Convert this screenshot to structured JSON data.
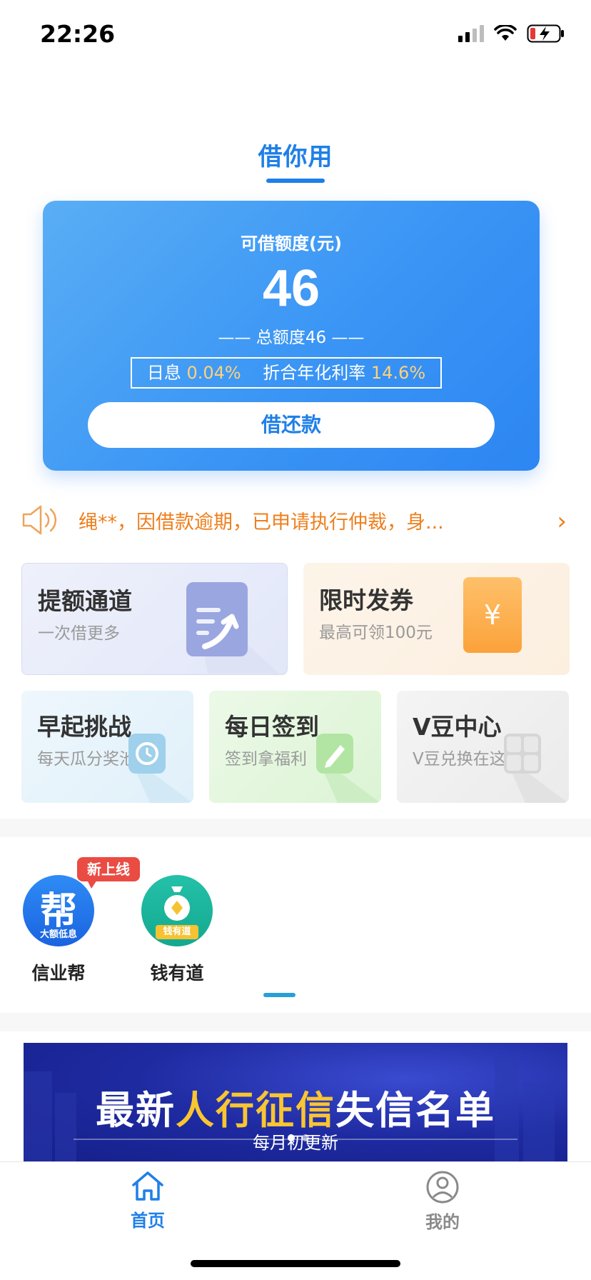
{
  "status_bar": {
    "time": "22:26"
  },
  "page": {
    "title": "借你用"
  },
  "credit_card": {
    "label": "可借额度(元)",
    "amount": "46",
    "total": "—— 总额度46 ——",
    "daily_rate_label": "日息",
    "daily_rate_value": "0.04%",
    "annual_rate_label": "折合年化利率",
    "annual_rate_value": "14.6%",
    "button_label": "借还款"
  },
  "notice": {
    "text": "绳**，因借款逾期，已申请执行仲裁，身...",
    "arrow": "›"
  },
  "tiles": [
    {
      "title": "提额通道",
      "subtitle": "一次借更多",
      "icon": "document-arrow-icon"
    },
    {
      "title": "限时发券",
      "subtitle": "最高可领100元",
      "icon": "coupon-icon",
      "icon_glyph": "¥"
    },
    {
      "title": "早起挑战",
      "subtitle": "每天瓜分奖池",
      "icon": "alarm-clock-icon"
    },
    {
      "title": "每日签到",
      "subtitle": "签到拿福利",
      "icon": "pencil-icon"
    },
    {
      "title": "V豆中心",
      "subtitle": "V豆兑换在这里",
      "icon": "cube-icon"
    }
  ],
  "apps": [
    {
      "name": "信业帮",
      "icon_text": "帮",
      "icon_caption": "大额低息",
      "badge": "新上线"
    },
    {
      "name": "钱有道",
      "icon_caption": "钱有道"
    }
  ],
  "banner": {
    "title_part1": "最新",
    "title_highlight": "人行征信",
    "title_part2": "失信名单",
    "subtitle": "每月初更新"
  },
  "tab_bar": {
    "home_label": "首页",
    "mine_label": "我的"
  },
  "colors": {
    "accent": "#1f7fe8",
    "notice": "#ee7f1d",
    "highlight": "#f9c531",
    "badge": "#ea4b42"
  }
}
